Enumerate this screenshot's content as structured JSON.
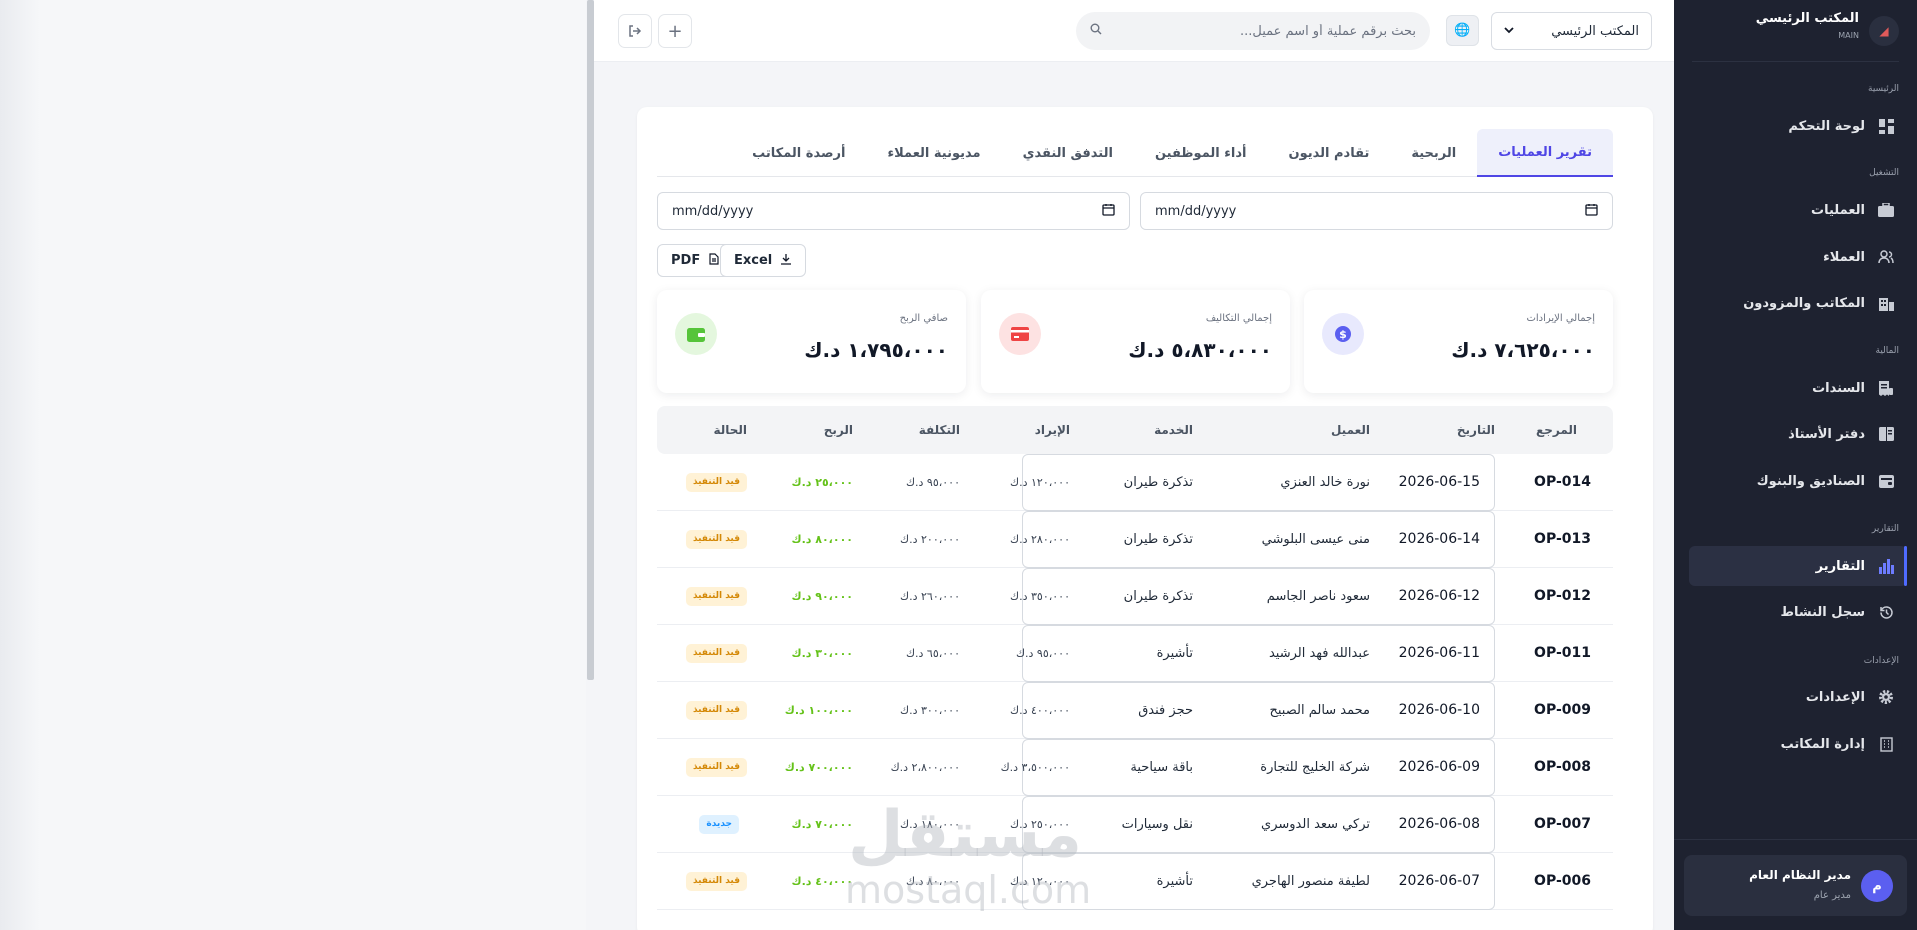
{
  "header": {
    "office_select": "المكتب الرئيسي",
    "search_placeholder": "بحث برقم عملية أو اسم عميل..."
  },
  "sidebar": {
    "brand_title": "المكتب الرئيسي",
    "brand_sub": "MAIN",
    "sections": {
      "main": "الرئيسية",
      "ops": "التشغيل",
      "finance": "المالية",
      "reports": "التقارير",
      "settings": "الإعدادات"
    },
    "items": {
      "dashboard": "لوحة التحكم",
      "operations": "العمليات",
      "clients": "العملاء",
      "offices": "المكاتب والمزودون",
      "vouchers": "السندات",
      "ledger": "دفتر الأستاذ",
      "banks": "الصناديق والبنوك",
      "reports": "التقارير",
      "activity": "سجل النشاط",
      "settings": "الإعدادات",
      "offices_mgmt": "إدارة المكاتب"
    },
    "user": {
      "name": "مدير النظام العام",
      "role": "مدير عام",
      "initial": "م"
    }
  },
  "tabs": [
    "تقرير العمليات",
    "الربحية",
    "تقادم الديون",
    "أداء الموظفين",
    "التدفق النقدي",
    "مديونية العملاء",
    "أرصدة المكاتب"
  ],
  "filters": {
    "date_placeholder": "mm/dd/yyyy",
    "excel_label": "Excel",
    "pdf_label": "PDF"
  },
  "stats": {
    "revenue": {
      "label": "إجمالي الإيرادات",
      "value": "٧،٦٢٥،٠٠٠ د.ك"
    },
    "costs": {
      "label": "إجمالي التكاليف",
      "value": "٥،٨٣٠،٠٠٠ د.ك"
    },
    "profit": {
      "label": "صافي الربح",
      "value": "١،٧٩٥،٠٠٠ د.ك"
    }
  },
  "table": {
    "headers": {
      "ref": "المرجع",
      "date": "التاريخ",
      "client": "العميل",
      "service": "الخدمة",
      "revenue": "الإيراد",
      "cost": "التكلفة",
      "profit": "الربح",
      "status": "الحالة"
    },
    "rows": [
      {
        "ref": "OP-014",
        "date": "2026-06-15",
        "client": "نورة خالد العنزي",
        "service": "تذكرة طيران",
        "revenue": "١٢٠،٠٠٠ د.ك",
        "cost": "٩٥،٠٠٠ د.ك",
        "profit": "٢٥،٠٠٠ د.ك",
        "status": "قيد التنفيذ",
        "status_type": "pending"
      },
      {
        "ref": "OP-013",
        "date": "2026-06-14",
        "client": "منى عيسى البلوشي",
        "service": "تذكرة طيران",
        "revenue": "٢٨٠،٠٠٠ د.ك",
        "cost": "٢٠٠،٠٠٠ د.ك",
        "profit": "٨٠،٠٠٠ د.ك",
        "status": "قيد التنفيذ",
        "status_type": "pending"
      },
      {
        "ref": "OP-012",
        "date": "2026-06-12",
        "client": "سعود ناصر الجاسم",
        "service": "تذكرة طيران",
        "revenue": "٣٥٠،٠٠٠ د.ك",
        "cost": "٢٦٠،٠٠٠ د.ك",
        "profit": "٩٠،٠٠٠ د.ك",
        "status": "قيد التنفيذ",
        "status_type": "pending"
      },
      {
        "ref": "OP-011",
        "date": "2026-06-11",
        "client": "عبدالله فهد الرشيد",
        "service": "تأشيرة",
        "revenue": "٩٥،٠٠٠ د.ك",
        "cost": "٦٥،٠٠٠ د.ك",
        "profit": "٣٠،٠٠٠ د.ك",
        "status": "قيد التنفيذ",
        "status_type": "pending"
      },
      {
        "ref": "OP-009",
        "date": "2026-06-10",
        "client": "محمد سالم الصبيح",
        "service": "حجز فندق",
        "revenue": "٤٠٠،٠٠٠ د.ك",
        "cost": "٣٠٠،٠٠٠ د.ك",
        "profit": "١٠٠،٠٠٠ د.ك",
        "status": "قيد التنفيذ",
        "status_type": "pending"
      },
      {
        "ref": "OP-008",
        "date": "2026-06-09",
        "client": "شركة الخليج للتجارة",
        "service": "باقة سياحية",
        "revenue": "٣،٥٠٠،٠٠٠ د.ك",
        "cost": "٢،٨٠٠،٠٠٠ د.ك",
        "profit": "٧٠٠،٠٠٠ د.ك",
        "status": "قيد التنفيذ",
        "status_type": "pending"
      },
      {
        "ref": "OP-007",
        "date": "2026-06-08",
        "client": "تركي سعد الدوسري",
        "service": "نقل وسيارات",
        "revenue": "٢٥٠،٠٠٠ د.ك",
        "cost": "١٨٠،٠٠٠ د.ك",
        "profit": "٧٠،٠٠٠ د.ك",
        "status": "جديدة",
        "status_type": "new"
      },
      {
        "ref": "OP-006",
        "date": "2026-06-07",
        "client": "لطيفة منصور الهاجري",
        "service": "تأشيرة",
        "revenue": "١٢٠،٠٠٠ د.ك",
        "cost": "٨٠،٠٠٠ د.ك",
        "profit": "٤٠،٠٠٠ د.ك",
        "status": "قيد التنفيذ",
        "status_type": "pending"
      }
    ]
  },
  "watermark": {
    "arabic": "مستقل",
    "latin": "mostaql.com"
  },
  "colors": {
    "accent": "#4f46e5",
    "sidebar_bg": "#1e2230",
    "profit_green": "#65c21a",
    "pending_bg": "#fff2d6",
    "pending_text": "#d48806",
    "new_bg": "#dff1ff",
    "new_text": "#1890ff"
  }
}
